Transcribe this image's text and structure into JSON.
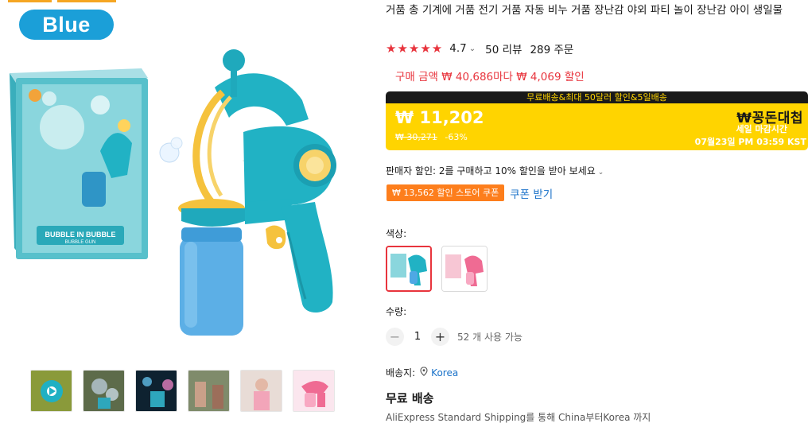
{
  "gallery": {
    "color_badge": "Blue",
    "box_text": "BUBBLE IN BUBBLE",
    "box_subtext": "BUBBLE GUN"
  },
  "product": {
    "title": "거품 총 기계에 거품 전기 거품 자동 비누 거품 장난감 야외 파티 놀이 장난감 아이 생일물",
    "rating": "4.7",
    "stars": "★★★★★",
    "reviews": "50 리뷰",
    "orders": "289 주문"
  },
  "promo": {
    "text": "구매 금액 ₩ 40,686마다 ₩ 4,069 할인"
  },
  "deal": {
    "banner": "무료배송&최대 50달러 할인&5일배송",
    "price": "₩ 11,202",
    "original_price": "₩ 30,271",
    "discount": "-63%",
    "brand": "₩꽁돈대첩",
    "sale_ends_label": "세일 마감시간",
    "sale_ends_time": "07월23일 PM 03:59 KST",
    "color": "#ffd400"
  },
  "seller_discount": "판매자 할인: 2를 구매하고 10% 할인을 받아 보세요",
  "coupon": {
    "tag": "₩ 13,562 할인 스토어 쿠폰",
    "link": "쿠폰 받기"
  },
  "color_option": {
    "label": "색상:",
    "options": [
      "Blue",
      "Pink"
    ]
  },
  "quantity": {
    "label": "수량:",
    "value": "1",
    "available": "52 개 사용 가능"
  },
  "shipping": {
    "ship_to_label": "배송지:",
    "country": "Korea",
    "free_label": "무료 배송",
    "method": "AliExpress Standard Shipping를 통해 China부터Korea 까지"
  },
  "colors": {
    "accent_red": "#e8343d",
    "link_blue": "#1a72c9",
    "coupon_orange": "#fd7e1c",
    "badge_blue": "#1b9fd8"
  }
}
